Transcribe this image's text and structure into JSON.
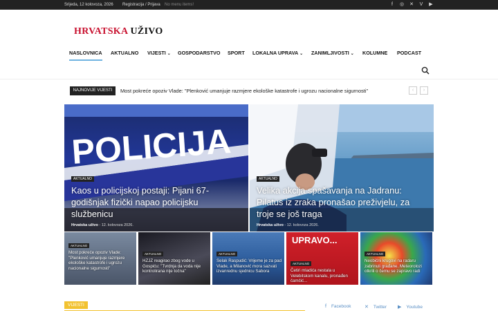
{
  "topbar": {
    "date": "Srijeda, 12 kolovoza, 2026",
    "register": "Registracija / Prijava",
    "no_menu": "No menu items!",
    "socials": [
      "facebook-icon",
      "instagram-icon",
      "x-icon",
      "vimeo-icon",
      "youtube-icon"
    ]
  },
  "logo": {
    "part1": "HRVATSKA",
    "part2": "UŽIVO",
    "color": "#c8102e"
  },
  "nav": [
    {
      "label": "NASLOVNICA"
    },
    {
      "label": "AKTUALNO"
    },
    {
      "label": "VIJESTI",
      "dropdown": true
    },
    {
      "label": "GOSPODARSTVO"
    },
    {
      "label": "SPORT"
    },
    {
      "label": "LOKALNA UPRAVA",
      "dropdown": true
    },
    {
      "label": "ZANIMLJIVOSTI",
      "dropdown": true
    },
    {
      "label": "KOLUMNE"
    },
    {
      "label": "PODCAST"
    }
  ],
  "ticker": {
    "label": "NAJNOVIJE VIJESTI",
    "text": "Most pokreće opoziv Vlade: \"Plenković umanjuje razmjere ekološke katastrofe i ugrozu nacionalne sigurnosti\""
  },
  "featured": [
    {
      "badge": "AKTUALNO",
      "title": "Kaos u policijskoj postaji: Pijani 67-godišnjak fizički napao policijsku službenicu",
      "author": "Hrvatska uživo",
      "date": "12. kolovoza 2026.",
      "image_text": "POLICIJA"
    },
    {
      "badge": "AKTUALNO",
      "title": "Velika akcija spašavanja na Jadranu: Pilatus iz zraka pronašao preživjelu, za troje se još traga",
      "author": "Hrvatska uživo",
      "date": "12. kolovoza 2026."
    }
  ],
  "small": [
    {
      "badge": "AKTUALNO",
      "title": "Most pokreće opoziv Vlade: \"Plenković umanjuje razmjere ekološke katastrofe i ugrozu nacionalne sigurnosti\""
    },
    {
      "badge": "AKTUALNO",
      "title": "HZJZ reagirao zbog vode u Gospiću: \"Tvrdnja da voda nije kontrolirana nije točna\""
    },
    {
      "badge": "AKTUALNO",
      "title": "Selak Raspudić: Vrijeme je za pad Vlade, a Milanović mora sazvati izvanrednu sjednicu Sabora"
    },
    {
      "badge": "AKTUALNO",
      "title": "Četiri mladića nestala u Velebitskom kanalu, pronađen čamčić...",
      "image_text": "UPRAVO..."
    },
    {
      "badge": "AKTUALNO",
      "title": "Neobični krugovi na radaru zabrinuli građane. Meteorolozi otkrili o čemu se zapravo radi"
    }
  ],
  "section": {
    "label": "VIJESTI"
  },
  "social_links": [
    {
      "icon": "facebook-icon",
      "label": "Facebook"
    },
    {
      "icon": "x-icon",
      "label": "Twitter"
    },
    {
      "icon": "youtube-icon",
      "label": "Youtube"
    }
  ]
}
